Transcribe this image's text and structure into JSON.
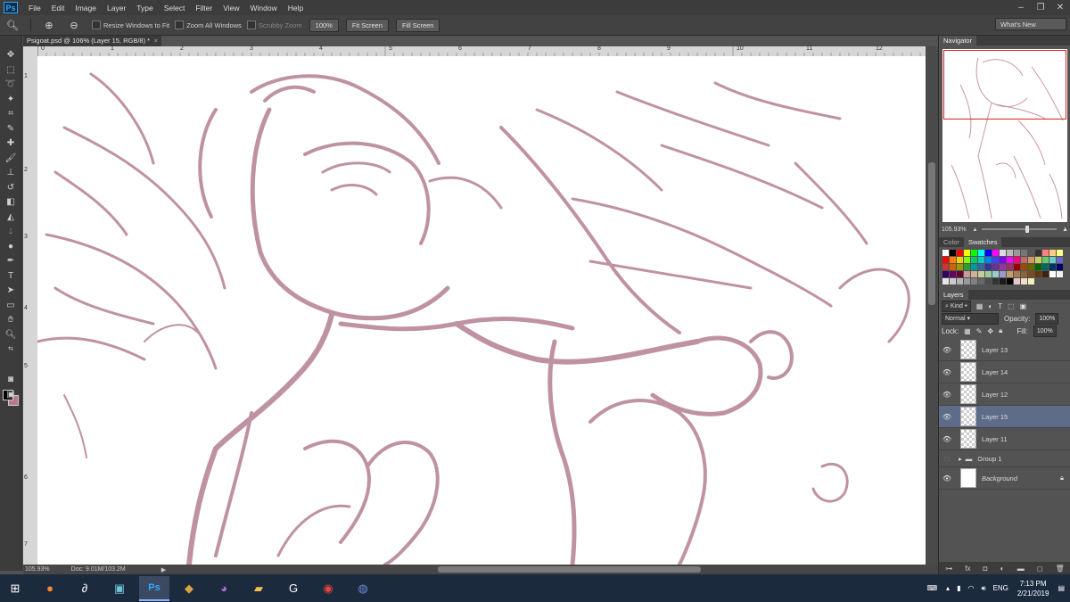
{
  "app": {
    "logo": "Ps",
    "menus": [
      "File",
      "Edit",
      "Image",
      "Layer",
      "Type",
      "Select",
      "Filter",
      "View",
      "Window",
      "Help"
    ]
  },
  "options": {
    "resize_windows": "Resize Windows to Fit",
    "zoom_all": "Zoom All Windows",
    "scrubby": "Scrubby Zoom",
    "zoom_100": "100%",
    "fit_screen": "Fit Screen",
    "fill_screen": "Fill Screen",
    "workspace": "What's New"
  },
  "document": {
    "tab_title": "Psigoat.psd @ 106% (Layer 15, RGB/8) *",
    "close": "×"
  },
  "ruler": {
    "top": [
      "0",
      "1",
      "2",
      "3",
      "4",
      "5",
      "6",
      "7",
      "8",
      "9",
      "10",
      "11",
      "12"
    ],
    "left": [
      "1",
      "2",
      "3",
      "4",
      "5",
      "6",
      "7"
    ]
  },
  "status": {
    "zoom": "105.93%",
    "doc": "Doc: 9.01M/103.2M"
  },
  "navigator": {
    "tab": "Navigator",
    "zoom": "105.93%"
  },
  "swatch_panel": {
    "tabs": [
      "Color",
      "Swatches"
    ],
    "colors": [
      "#ffffff",
      "#000000",
      "#ff0000",
      "#ffff00",
      "#00ff00",
      "#00ffff",
      "#0000ff",
      "#ff00ff",
      "#dddddd",
      "#bbbbbb",
      "#999999",
      "#777777",
      "#555555",
      "#333333",
      "#ff8080",
      "#ffcc80",
      "#ffff80",
      "#ff0000",
      "#ff8000",
      "#ffcc00",
      "#80ff00",
      "#00cc66",
      "#00cccc",
      "#0080ff",
      "#4040ff",
      "#8000ff",
      "#ff00ff",
      "#ff0080",
      "#cc6666",
      "#cc9966",
      "#cccc66",
      "#66cc66",
      "#66cccc",
      "#6666cc",
      "#cc3333",
      "#cc6600",
      "#999900",
      "#339933",
      "#009999",
      "#336699",
      "#333399",
      "#663399",
      "#993399",
      "#993366",
      "#990000",
      "#994c00",
      "#666600",
      "#006600",
      "#006666",
      "#003366",
      "#000066",
      "#330066",
      "#660066",
      "#660033",
      "#cc9999",
      "#ccb399",
      "#cccc99",
      "#99cc99",
      "#99cccc",
      "#9999cc",
      "#c69c6d",
      "#a67c52",
      "#8c6239",
      "#754c24",
      "#603913",
      "#42210b",
      "#ffffff",
      "#f2f2f2",
      "#e6e6e6",
      "#cccccc",
      "#b3b3b3",
      "#999999",
      "#808080",
      "#666666",
      "#4d4d4d",
      "#333333",
      "#1a1a1a",
      "#000000",
      "#e8c4c4",
      "#f0e0c0",
      "#f0f0c0"
    ]
  },
  "layers": {
    "tab": "Layers",
    "filter": "Kind",
    "blend": "Normal",
    "opacity_label": "Opacity:",
    "opacity": "100%",
    "lock_label": "Lock:",
    "fill_label": "Fill:",
    "fill": "100%",
    "items": [
      {
        "name": "Layer 13"
      },
      {
        "name": "Layer 14"
      },
      {
        "name": "Layer 12"
      },
      {
        "name": "Layer 15"
      },
      {
        "name": "Layer 11"
      },
      {
        "name": "Group 1"
      },
      {
        "name": "Background"
      }
    ]
  },
  "taskbar": {
    "lang": "ENG",
    "time": "7:13 PM",
    "date": "2/21/2019"
  }
}
